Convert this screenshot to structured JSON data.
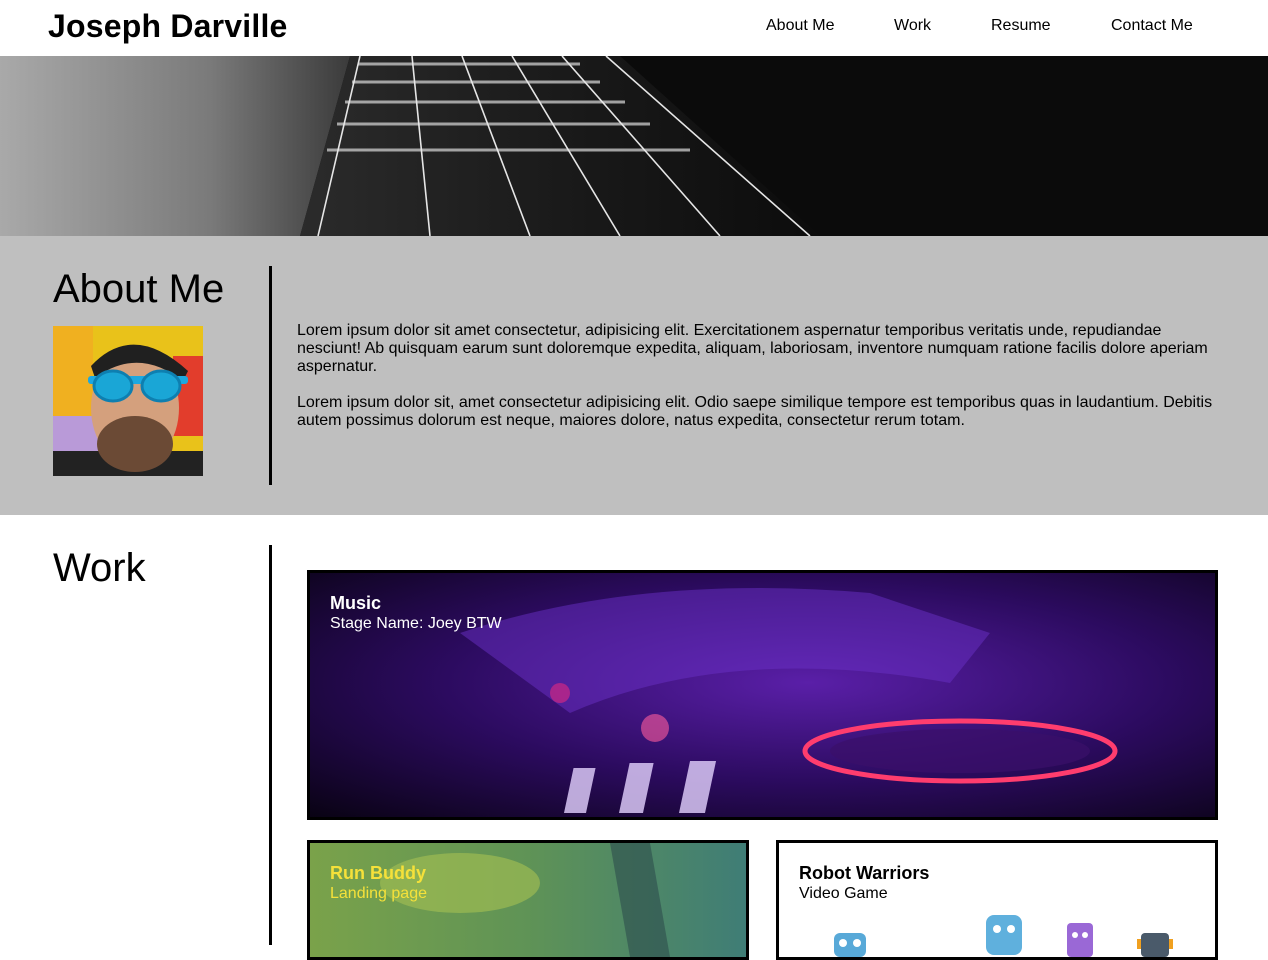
{
  "header": {
    "site_title": "Joseph Darville",
    "nav": {
      "about": "About Me",
      "work": "Work",
      "resume": "Resume",
      "contact": "Contact Me"
    }
  },
  "about": {
    "heading": "About Me",
    "paragraphs": [
      "Lorem ipsum dolor sit amet consectetur, adipisicing elit. Exercitationem aspernatur temporibus veritatis unde, repudiandae nesciunt! Ab quisquam earum sunt doloremque expedita, aliquam, laboriosam, inventore numquam ratione facilis dolore aperiam aspernatur.",
      "Lorem ipsum dolor sit, amet consectetur adipisicing elit. Odio saepe similique tempore est temporibus quas in laudantium. Debitis autem possimus dolorum est neque, maiores dolore, natus expedita, consectetur rerum totam."
    ]
  },
  "work": {
    "heading": "Work",
    "projects": [
      {
        "title": "Music",
        "subtitle": "Stage Name: Joey BTW"
      },
      {
        "title": "Run Buddy",
        "subtitle": "Landing page"
      },
      {
        "title": "Robot Warriors",
        "subtitle": "Video Game"
      }
    ]
  },
  "colors": {
    "about_bg": "#bfbfbf",
    "run_buddy_text": "#f5e13a",
    "music_text": "#ffffff"
  }
}
